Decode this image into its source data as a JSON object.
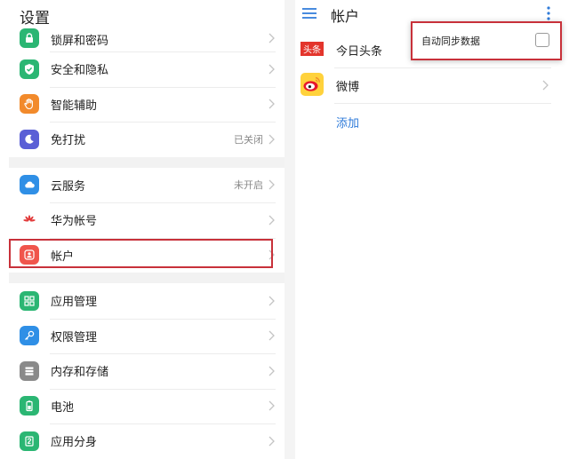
{
  "left": {
    "title": "设置",
    "groups": [
      [
        {
          "label": "锁屏和密码",
          "icon": "lock-icon",
          "color": "#2bb673",
          "value": ""
        },
        {
          "label": "安全和隐私",
          "icon": "shield-check-icon",
          "color": "#2bb673",
          "value": ""
        },
        {
          "label": "智能辅助",
          "icon": "hand-icon",
          "color": "#f28a2b",
          "value": ""
        },
        {
          "label": "免打扰",
          "icon": "moon-icon",
          "color": "#5a5fd6",
          "value": "已关闭"
        }
      ],
      [
        {
          "label": "云服务",
          "icon": "cloud-icon",
          "color": "#2f8fe6",
          "value": "未开启"
        },
        {
          "label": "华为帐号",
          "icon": "huawei-logo-icon",
          "color": "#ffffff",
          "value": ""
        },
        {
          "label": "帐户",
          "icon": "user-icon",
          "color": "#f0554c",
          "value": ""
        }
      ],
      [
        {
          "label": "应用管理",
          "icon": "apps-grid-icon",
          "color": "#2bb673",
          "value": ""
        },
        {
          "label": "权限管理",
          "icon": "key-icon",
          "color": "#2f8fe6",
          "value": ""
        },
        {
          "label": "内存和存储",
          "icon": "storage-icon",
          "color": "#8a8a8a",
          "value": ""
        },
        {
          "label": "电池",
          "icon": "battery-icon",
          "color": "#2bb673",
          "value": ""
        },
        {
          "label": "应用分身",
          "icon": "app-twin-icon",
          "color": "#2bb673",
          "value": ""
        }
      ]
    ]
  },
  "right": {
    "title": "帐户",
    "accounts": [
      {
        "label": "今日头条",
        "logo_text": "头条"
      },
      {
        "label": "微博",
        "logo_text": ""
      }
    ],
    "add_label": "添加",
    "popup": {
      "label": "自动同步数据",
      "checked": false
    }
  },
  "colors": {
    "highlight": "#c8313a",
    "link": "#2f7bd9"
  }
}
